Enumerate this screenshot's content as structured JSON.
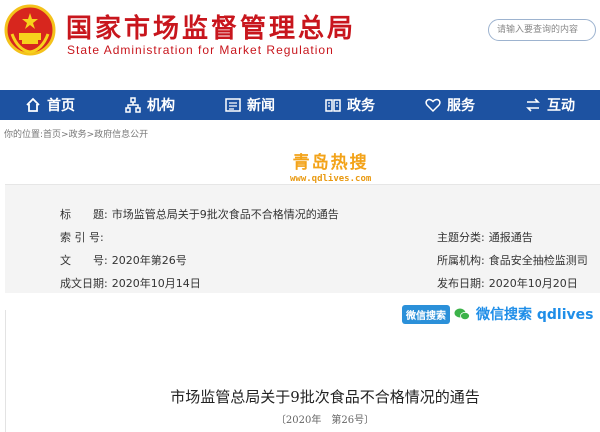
{
  "header": {
    "title": "国家市场监督管理总局",
    "subtitle": "State Administration for Market Regulation",
    "search_placeholder": "请输入要查询的内容"
  },
  "nav": [
    {
      "label": "首页",
      "icon": "home-icon"
    },
    {
      "label": "机构",
      "icon": "org-icon"
    },
    {
      "label": "新闻",
      "icon": "news-icon"
    },
    {
      "label": "政务",
      "icon": "gov-icon"
    },
    {
      "label": "服务",
      "icon": "heart-icon"
    },
    {
      "label": "互动",
      "icon": "exchange-icon"
    }
  ],
  "breadcrumb": "你的位置:首页>政务>政府信息公开",
  "watermark_top": {
    "text": "青岛热搜",
    "url": "www.qdlives.com"
  },
  "info": {
    "title_label": "标　　题:",
    "title_value": "市场监管总局关于9批次食品不合格情况的通告",
    "index_label": "索 引 号:",
    "index_value": "",
    "doc_label": "文　　号:",
    "doc_value": "2020年第26号",
    "date_label": "成文日期:",
    "date_value": "2020年10月14日",
    "category_label": "主题分类:",
    "category_value": "通报通告",
    "org_label": "所属机构:",
    "org_value": "食品安全抽检监测司",
    "publish_label": "发布日期:",
    "publish_value": "2020年10月20日"
  },
  "watermark_wx": {
    "badge": "微信搜索",
    "text": "微信搜索 qdlives"
  },
  "doc": {
    "title": "市场监管总局关于9批次食品不合格情况的通告",
    "number": "〔2020年　第26号〕"
  },
  "colors": {
    "brand_red": "#c8161d",
    "nav_blue": "#1d52a1",
    "watermark_orange": "#f3a319",
    "wechat_blue": "#1f8ee8"
  }
}
